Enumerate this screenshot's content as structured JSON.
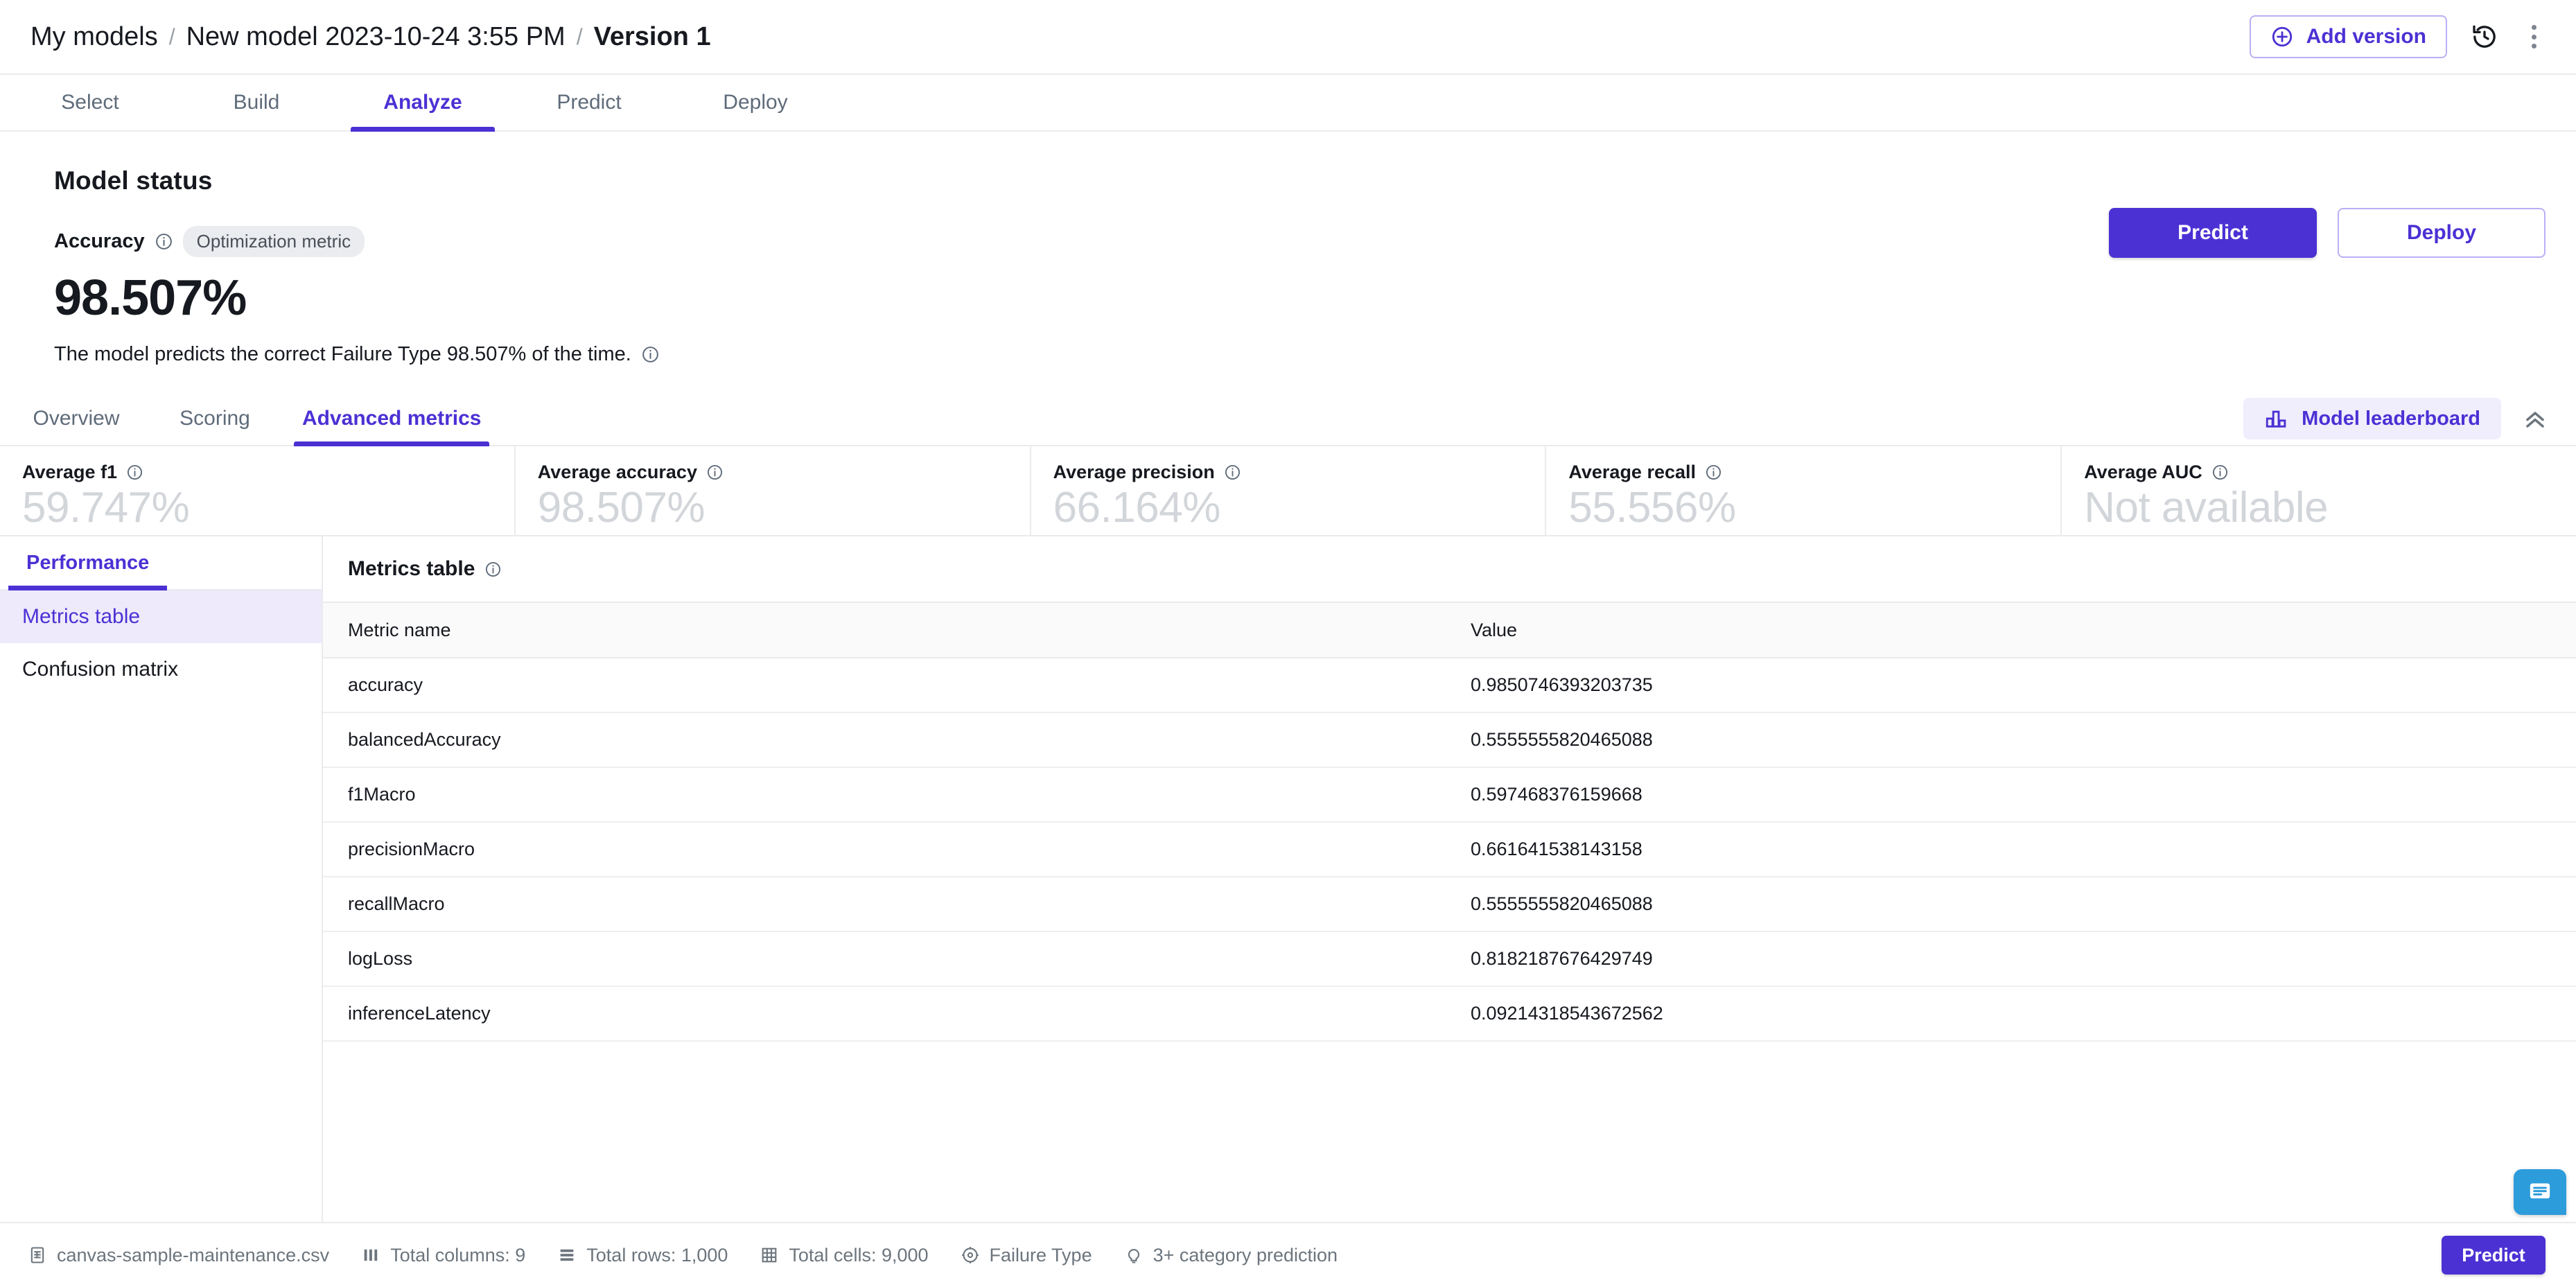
{
  "topbar": {
    "breadcrumb": [
      {
        "label": "My models",
        "current": false
      },
      {
        "label": "New model 2023-10-24 3:55 PM",
        "current": false
      },
      {
        "label": "Version 1",
        "current": true
      }
    ],
    "separator": "/",
    "add_version_label": "Add version",
    "add_version_icon": "plus-circle-icon",
    "history_icon": "history-icon",
    "more_icon": "kebab-menu-icon"
  },
  "main_tabs": [
    {
      "label": "Select",
      "active": false
    },
    {
      "label": "Build",
      "active": false
    },
    {
      "label": "Analyze",
      "active": true
    },
    {
      "label": "Predict",
      "active": false
    },
    {
      "label": "Deploy",
      "active": false
    }
  ],
  "model_status": {
    "title": "Model status",
    "metric_label": "Accuracy",
    "badge": "Optimization metric",
    "value": "98.507%",
    "description": "The model predicts the correct Failure Type 98.507% of the time.",
    "predict_label": "Predict",
    "deploy_label": "Deploy"
  },
  "sub_tabs": [
    {
      "label": "Overview",
      "active": false
    },
    {
      "label": "Scoring",
      "active": false
    },
    {
      "label": "Advanced metrics",
      "active": true
    }
  ],
  "leaderboard": {
    "label": "Model leaderboard",
    "icon": "bar-chart-icon",
    "collapse_icon": "double-chevron-up-icon"
  },
  "metric_cards": [
    {
      "label": "Average f1",
      "value": "59.747%"
    },
    {
      "label": "Average accuracy",
      "value": "98.507%"
    },
    {
      "label": "Average precision",
      "value": "66.164%"
    },
    {
      "label": "Average recall",
      "value": "55.556%"
    },
    {
      "label": "Average AUC",
      "value": "Not available"
    }
  ],
  "left_pane": {
    "tab_label": "Performance",
    "items": [
      {
        "label": "Metrics table",
        "active": true
      },
      {
        "label": "Confusion matrix",
        "active": false
      }
    ]
  },
  "metrics_table": {
    "title": "Metrics table",
    "columns": [
      "Metric name",
      "Value"
    ],
    "rows": [
      {
        "name": "accuracy",
        "value": "0.9850746393203735"
      },
      {
        "name": "balancedAccuracy",
        "value": "0.5555555820465088"
      },
      {
        "name": "f1Macro",
        "value": "0.597468376159668"
      },
      {
        "name": "precisionMacro",
        "value": "0.661641538143158"
      },
      {
        "name": "recallMacro",
        "value": "0.5555555820465088"
      },
      {
        "name": "logLoss",
        "value": "0.8182187676429749"
      },
      {
        "name": "inferenceLatency",
        "value": "0.09214318543672562"
      }
    ]
  },
  "bottombar": {
    "items": [
      {
        "icon": "file-csv-icon",
        "label": "canvas-sample-maintenance.csv"
      },
      {
        "icon": "columns-icon",
        "label": "Total columns: 9"
      },
      {
        "icon": "rows-icon",
        "label": "Total rows: 1,000"
      },
      {
        "icon": "grid-icon",
        "label": "Total cells: 9,000"
      },
      {
        "icon": "target-icon",
        "label": "Failure Type"
      },
      {
        "icon": "lightbulb-icon",
        "label": "3+ category prediction"
      }
    ],
    "predict_label": "Predict",
    "chat_icon": "chat-bubble-icon"
  },
  "colors": {
    "accent": "#4b31d4",
    "accent_soft": "#f0edfd",
    "border": "#e9ebed",
    "muted_text": "#6c757d",
    "metric_value": "#d2d5d9",
    "chat": "#2d9cdb"
  }
}
